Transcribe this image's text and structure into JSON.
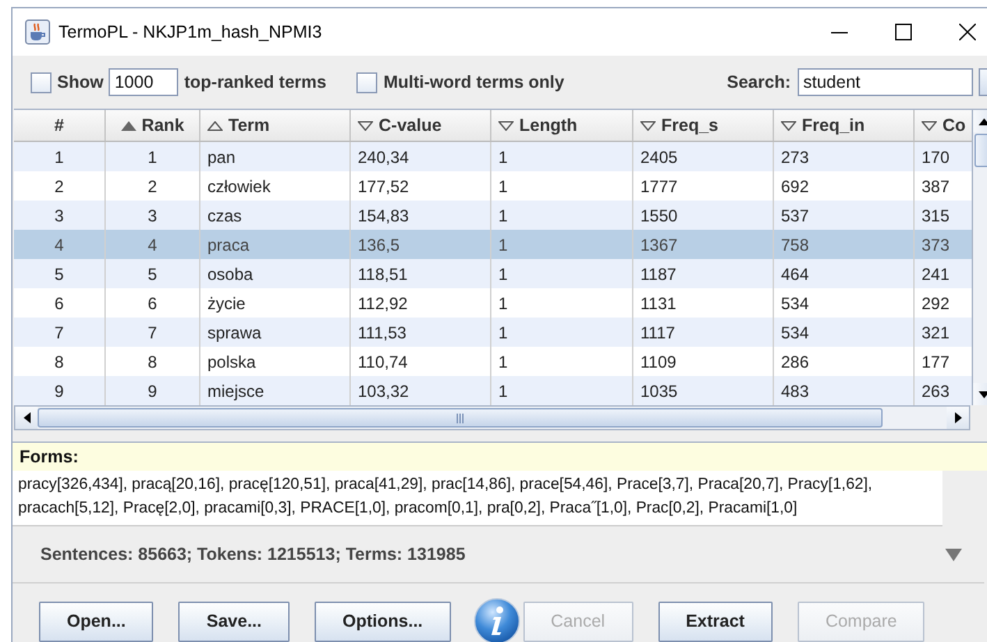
{
  "window": {
    "title": "TermoPL - NKJP1m_hash_NPMI3"
  },
  "toolbar": {
    "show_checkbox": {
      "label": "Show",
      "checked": false
    },
    "show_count": "1000",
    "show_suffix": "top-ranked terms",
    "multiword_checkbox": {
      "label": "Multi-word terms only",
      "checked": false
    },
    "search_label": "Search:",
    "search_value": "student"
  },
  "table": {
    "columns": [
      {
        "label": "#",
        "kind": "plain"
      },
      {
        "label": "Rank",
        "kind": "primary"
      },
      {
        "label": "Term",
        "kind": "ascending"
      },
      {
        "label": "C-value",
        "kind": "descending"
      },
      {
        "label": "Length",
        "kind": "descending"
      },
      {
        "label": "Freq_s",
        "kind": "descending"
      },
      {
        "label": "Freq_in",
        "kind": "descending"
      },
      {
        "label": "Co",
        "kind": "descending"
      }
    ],
    "rows": [
      {
        "cells": [
          "1",
          "1",
          "pan",
          "240,34",
          "1",
          "2405",
          "273",
          "170"
        ],
        "selected": false
      },
      {
        "cells": [
          "2",
          "2",
          "człowiek",
          "177,52",
          "1",
          "1777",
          "692",
          "387"
        ],
        "selected": false
      },
      {
        "cells": [
          "3",
          "3",
          "czas",
          "154,83",
          "1",
          "1550",
          "537",
          "315"
        ],
        "selected": false
      },
      {
        "cells": [
          "4",
          "4",
          "praca",
          "136,5",
          "1",
          "1367",
          "758",
          "373"
        ],
        "selected": true
      },
      {
        "cells": [
          "5",
          "5",
          "osoba",
          "118,51",
          "1",
          "1187",
          "464",
          "241"
        ],
        "selected": false
      },
      {
        "cells": [
          "6",
          "6",
          "życie",
          "112,92",
          "1",
          "1131",
          "534",
          "292"
        ],
        "selected": false
      },
      {
        "cells": [
          "7",
          "7",
          "sprawa",
          "111,53",
          "1",
          "1117",
          "534",
          "321"
        ],
        "selected": false
      },
      {
        "cells": [
          "8",
          "8",
          "polska",
          "110,74",
          "1",
          "1109",
          "286",
          "177"
        ],
        "selected": false
      },
      {
        "cells": [
          "9",
          "9",
          "miejsce",
          "103,32",
          "1",
          "1035",
          "483",
          "263"
        ],
        "selected": false
      }
    ]
  },
  "forms": {
    "label": "Forms:",
    "text": "pracy[326,434], pracą[20,16], pracę[120,51], praca[41,29], prac[14,86], prace[54,46], Prace[3,7], Praca[20,7], Pracy[1,62], pracach[5,12], Pracę[2,0], pracami[0,3], PRACE[1,0], pracom[0,1], pra[0,2], Praca˝[1,0], Prac[0,2], Pracami[1,0]"
  },
  "status": "Sentences: 85663; Tokens: 1215513; Terms: 131985",
  "buttons": [
    {
      "kind": "button",
      "label": "Open...",
      "disabled": false
    },
    {
      "kind": "button",
      "label": "Save...",
      "disabled": false
    },
    {
      "kind": "button",
      "label": "Options...",
      "disabled": false
    },
    {
      "kind": "info"
    },
    {
      "kind": "button",
      "label": "Cancel",
      "disabled": true
    },
    {
      "kind": "button",
      "label": "Extract",
      "disabled": false
    },
    {
      "kind": "button",
      "label": "Compare",
      "disabled": true
    }
  ]
}
